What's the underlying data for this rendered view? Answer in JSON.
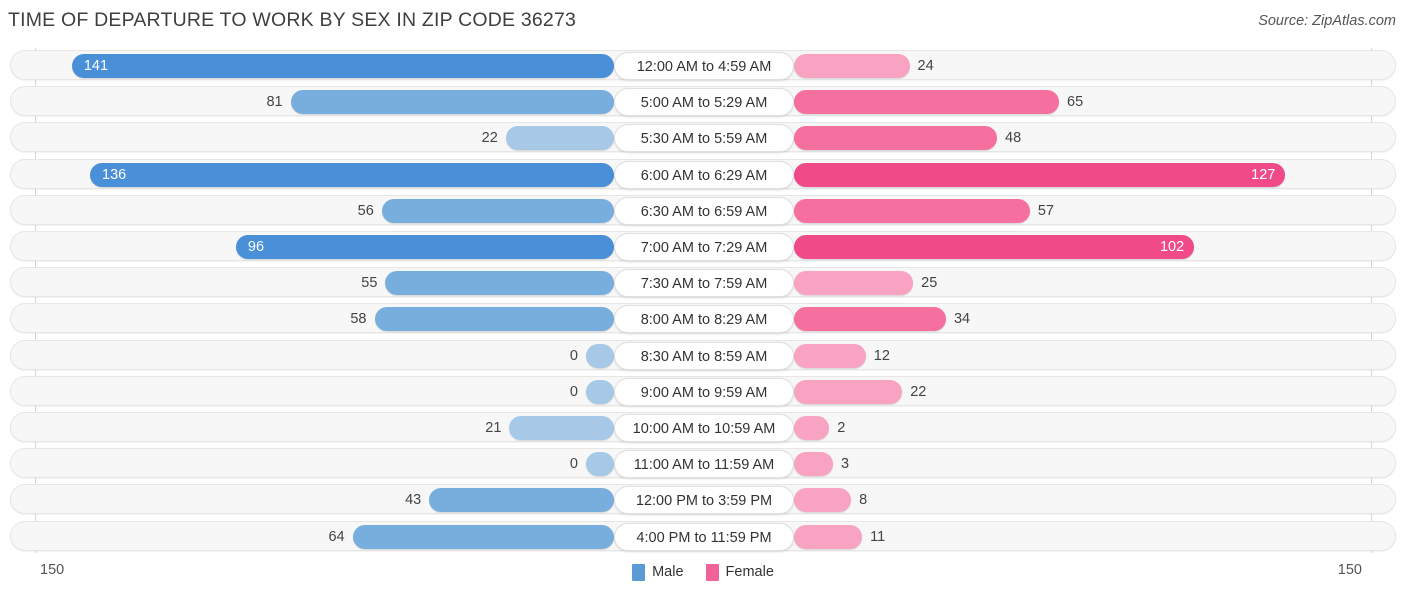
{
  "header": {
    "title": "TIME OF DEPARTURE TO WORK BY SEX IN ZIP CODE 36273",
    "source": "Source: ZipAtlas.com"
  },
  "footer": {
    "axis_max_left": "150",
    "axis_max_right": "150"
  },
  "legend": {
    "items": [
      {
        "label": "Male",
        "color": "#5b9bd5"
      },
      {
        "label": "Female",
        "color": "#f2629a"
      }
    ]
  },
  "colors": {
    "male_dark": "#4a90d9",
    "male_mid": "#77aede",
    "male_light": "#a8c8e8",
    "female_dark": "#f04b88",
    "female_mid": "#f5709e",
    "female_light": "#f9a3c2",
    "track_bg": "#f7f7f7",
    "track_border": "#e6e6e6",
    "gridline": "#d6d6d6"
  },
  "chart_data": {
    "type": "bar",
    "title": "TIME OF DEPARTURE TO WORK BY SEX IN ZIP CODE 36273",
    "subtitle": "",
    "xlabel": "",
    "ylabel": "",
    "orientation": "horizontal-diverging",
    "axis_max": 150,
    "xlim": [
      150,
      150
    ],
    "grid": true,
    "legend_position": "bottom-center",
    "categories": [
      "12:00 AM to 4:59 AM",
      "5:00 AM to 5:29 AM",
      "5:30 AM to 5:59 AM",
      "6:00 AM to 6:29 AM",
      "6:30 AM to 6:59 AM",
      "7:00 AM to 7:29 AM",
      "7:30 AM to 7:59 AM",
      "8:00 AM to 8:29 AM",
      "8:30 AM to 8:59 AM",
      "9:00 AM to 9:59 AM",
      "10:00 AM to 10:59 AM",
      "11:00 AM to 11:59 AM",
      "12:00 PM to 3:59 PM",
      "4:00 PM to 11:59 PM"
    ],
    "series": [
      {
        "name": "Male",
        "color": "#5b9bd5",
        "side": "left",
        "values": [
          141,
          81,
          22,
          136,
          56,
          96,
          55,
          58,
          0,
          0,
          21,
          0,
          43,
          64
        ]
      },
      {
        "name": "Female",
        "color": "#f2629a",
        "side": "right",
        "values": [
          24,
          65,
          48,
          127,
          57,
          102,
          25,
          34,
          12,
          22,
          2,
          3,
          8,
          11
        ]
      }
    ]
  }
}
